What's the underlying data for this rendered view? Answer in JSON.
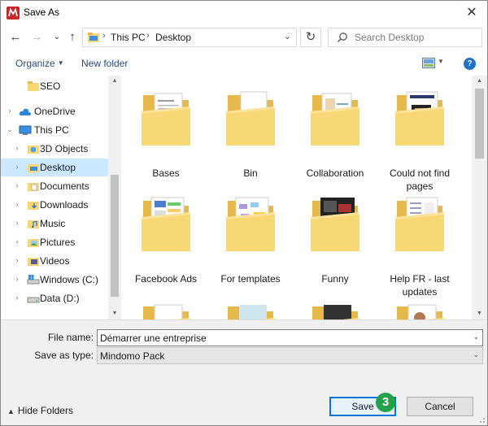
{
  "window": {
    "title": "Save As",
    "close_glyph": "✕"
  },
  "address": {
    "segments": [
      "This PC",
      "Desktop"
    ],
    "separator": "›",
    "search_placeholder": "Search Desktop"
  },
  "toolbar": {
    "organize_label": "Organize",
    "new_folder_label": "New folder",
    "help_label": "?"
  },
  "nav": {
    "items": [
      {
        "label": "SEO",
        "icon": "folder-icon",
        "expandable": false,
        "selected": false
      },
      {
        "label": "OneDrive",
        "icon": "onedrive-cloud-icon",
        "expandable": true,
        "selected": false
      },
      {
        "label": "This PC",
        "icon": "this-pc-icon",
        "expandable": true,
        "expanded": true,
        "selected": false
      },
      {
        "label": "3D Objects",
        "icon": "3d-objects-icon",
        "expandable": true,
        "selected": false
      },
      {
        "label": "Desktop",
        "icon": "desktop-folder-icon",
        "expandable": true,
        "selected": true
      },
      {
        "label": "Documents",
        "icon": "documents-folder-icon",
        "expandable": true,
        "selected": false
      },
      {
        "label": "Downloads",
        "icon": "downloads-folder-icon",
        "expandable": true,
        "selected": false
      },
      {
        "label": "Music",
        "icon": "music-folder-icon",
        "expandable": true,
        "selected": false
      },
      {
        "label": "Pictures",
        "icon": "pictures-folder-icon",
        "expandable": true,
        "selected": false
      },
      {
        "label": "Videos",
        "icon": "videos-folder-icon",
        "expandable": true,
        "selected": false
      },
      {
        "label": "Windows (C:)",
        "icon": "windows-drive-icon",
        "expandable": true,
        "selected": false
      },
      {
        "label": "Data (D:)",
        "icon": "data-drive-icon",
        "expandable": true,
        "selected": false
      }
    ]
  },
  "folders": [
    {
      "label": "Bases"
    },
    {
      "label": "Bin"
    },
    {
      "label": "Collaboration"
    },
    {
      "label": "Could not find pages"
    },
    {
      "label": "Facebook Ads"
    },
    {
      "label": "For templates"
    },
    {
      "label": "Funny"
    },
    {
      "label": "Help FR - last updates"
    },
    {
      "label": ""
    },
    {
      "label": ""
    },
    {
      "label": ""
    },
    {
      "label": ""
    }
  ],
  "form": {
    "file_name_label": "File name:",
    "file_name_value": "Démarrer une entreprise",
    "save_type_label": "Save as type:",
    "save_type_value": "Mindomo Pack"
  },
  "footer": {
    "hide_folders_label": "Hide Folders",
    "save_label": "Save",
    "cancel_label": "Cancel",
    "step_badge": "3"
  },
  "colors": {
    "accent": "#0078d7",
    "selection": "#cce8ff",
    "folder": "#f8d775",
    "step_badge": "#24a14b"
  }
}
